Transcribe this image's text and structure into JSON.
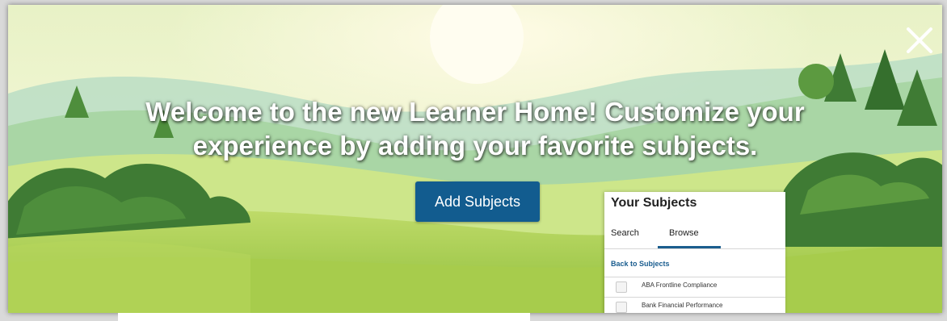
{
  "modal": {
    "headline_line1": "Welcome to the new Learner Home! Customize your",
    "headline_line2": "experience by adding your favorite subjects.",
    "add_button_label": "Add Subjects",
    "close_icon": "close-icon"
  },
  "subjects_panel": {
    "title": "Your Subjects",
    "tabs": [
      {
        "label": "Search",
        "active": false
      },
      {
        "label": "Browse",
        "active": true
      }
    ],
    "back_link": "Back to Subjects",
    "items": [
      {
        "label": "ABA Frontline Compliance",
        "checked": false
      },
      {
        "label": "Bank Financial Performance",
        "checked": false
      }
    ]
  },
  "colors": {
    "primary_button": "#125c8f",
    "tab_accent": "#1b5e8e",
    "link": "#1a5d8f"
  }
}
